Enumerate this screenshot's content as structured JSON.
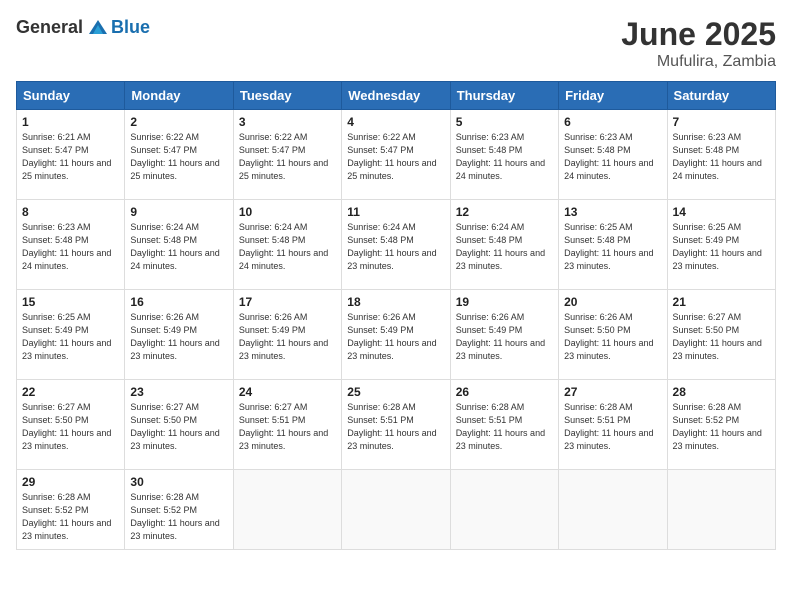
{
  "header": {
    "logo_general": "General",
    "logo_blue": "Blue",
    "title": "June 2025",
    "location": "Mufulira, Zambia"
  },
  "weekdays": [
    "Sunday",
    "Monday",
    "Tuesday",
    "Wednesday",
    "Thursday",
    "Friday",
    "Saturday"
  ],
  "weeks": [
    [
      {
        "day": "1",
        "info": "Sunrise: 6:21 AM\nSunset: 5:47 PM\nDaylight: 11 hours\nand 25 minutes."
      },
      {
        "day": "2",
        "info": "Sunrise: 6:22 AM\nSunset: 5:47 PM\nDaylight: 11 hours\nand 25 minutes."
      },
      {
        "day": "3",
        "info": "Sunrise: 6:22 AM\nSunset: 5:47 PM\nDaylight: 11 hours\nand 25 minutes."
      },
      {
        "day": "4",
        "info": "Sunrise: 6:22 AM\nSunset: 5:47 PM\nDaylight: 11 hours\nand 25 minutes."
      },
      {
        "day": "5",
        "info": "Sunrise: 6:23 AM\nSunset: 5:48 PM\nDaylight: 11 hours\nand 24 minutes."
      },
      {
        "day": "6",
        "info": "Sunrise: 6:23 AM\nSunset: 5:48 PM\nDaylight: 11 hours\nand 24 minutes."
      },
      {
        "day": "7",
        "info": "Sunrise: 6:23 AM\nSunset: 5:48 PM\nDaylight: 11 hours\nand 24 minutes."
      }
    ],
    [
      {
        "day": "8",
        "info": "Sunrise: 6:23 AM\nSunset: 5:48 PM\nDaylight: 11 hours\nand 24 minutes."
      },
      {
        "day": "9",
        "info": "Sunrise: 6:24 AM\nSunset: 5:48 PM\nDaylight: 11 hours\nand 24 minutes."
      },
      {
        "day": "10",
        "info": "Sunrise: 6:24 AM\nSunset: 5:48 PM\nDaylight: 11 hours\nand 24 minutes."
      },
      {
        "day": "11",
        "info": "Sunrise: 6:24 AM\nSunset: 5:48 PM\nDaylight: 11 hours\nand 23 minutes."
      },
      {
        "day": "12",
        "info": "Sunrise: 6:24 AM\nSunset: 5:48 PM\nDaylight: 11 hours\nand 23 minutes."
      },
      {
        "day": "13",
        "info": "Sunrise: 6:25 AM\nSunset: 5:48 PM\nDaylight: 11 hours\nand 23 minutes."
      },
      {
        "day": "14",
        "info": "Sunrise: 6:25 AM\nSunset: 5:49 PM\nDaylight: 11 hours\nand 23 minutes."
      }
    ],
    [
      {
        "day": "15",
        "info": "Sunrise: 6:25 AM\nSunset: 5:49 PM\nDaylight: 11 hours\nand 23 minutes."
      },
      {
        "day": "16",
        "info": "Sunrise: 6:26 AM\nSunset: 5:49 PM\nDaylight: 11 hours\nand 23 minutes."
      },
      {
        "day": "17",
        "info": "Sunrise: 6:26 AM\nSunset: 5:49 PM\nDaylight: 11 hours\nand 23 minutes."
      },
      {
        "day": "18",
        "info": "Sunrise: 6:26 AM\nSunset: 5:49 PM\nDaylight: 11 hours\nand 23 minutes."
      },
      {
        "day": "19",
        "info": "Sunrise: 6:26 AM\nSunset: 5:49 PM\nDaylight: 11 hours\nand 23 minutes."
      },
      {
        "day": "20",
        "info": "Sunrise: 6:26 AM\nSunset: 5:50 PM\nDaylight: 11 hours\nand 23 minutes."
      },
      {
        "day": "21",
        "info": "Sunrise: 6:27 AM\nSunset: 5:50 PM\nDaylight: 11 hours\nand 23 minutes."
      }
    ],
    [
      {
        "day": "22",
        "info": "Sunrise: 6:27 AM\nSunset: 5:50 PM\nDaylight: 11 hours\nand 23 minutes."
      },
      {
        "day": "23",
        "info": "Sunrise: 6:27 AM\nSunset: 5:50 PM\nDaylight: 11 hours\nand 23 minutes."
      },
      {
        "day": "24",
        "info": "Sunrise: 6:27 AM\nSunset: 5:51 PM\nDaylight: 11 hours\nand 23 minutes."
      },
      {
        "day": "25",
        "info": "Sunrise: 6:28 AM\nSunset: 5:51 PM\nDaylight: 11 hours\nand 23 minutes."
      },
      {
        "day": "26",
        "info": "Sunrise: 6:28 AM\nSunset: 5:51 PM\nDaylight: 11 hours\nand 23 minutes."
      },
      {
        "day": "27",
        "info": "Sunrise: 6:28 AM\nSunset: 5:51 PM\nDaylight: 11 hours\nand 23 minutes."
      },
      {
        "day": "28",
        "info": "Sunrise: 6:28 AM\nSunset: 5:52 PM\nDaylight: 11 hours\nand 23 minutes."
      }
    ],
    [
      {
        "day": "29",
        "info": "Sunrise: 6:28 AM\nSunset: 5:52 PM\nDaylight: 11 hours\nand 23 minutes."
      },
      {
        "day": "30",
        "info": "Sunrise: 6:28 AM\nSunset: 5:52 PM\nDaylight: 11 hours\nand 23 minutes."
      },
      null,
      null,
      null,
      null,
      null
    ]
  ]
}
